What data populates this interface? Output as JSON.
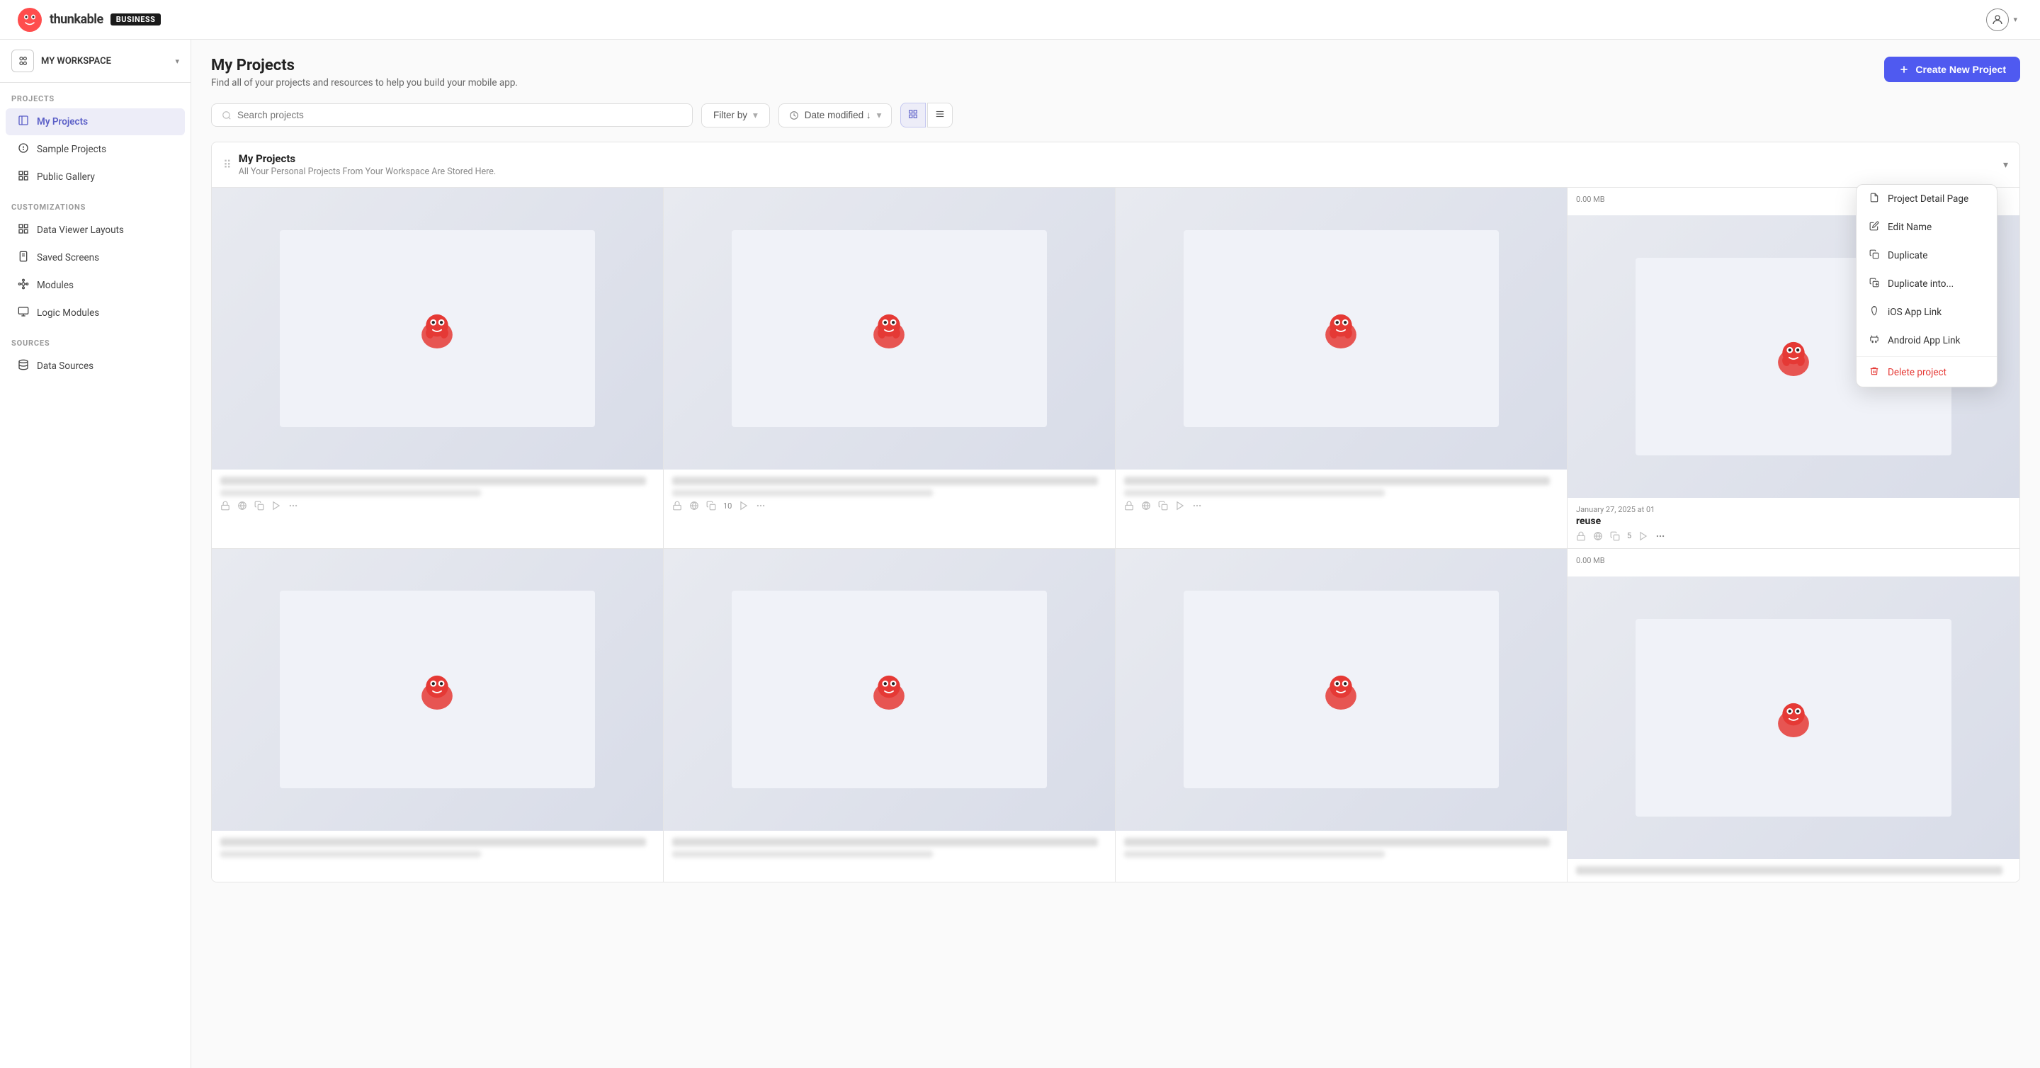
{
  "header": {
    "logo_text": "thunkable",
    "business_badge": "BUSINESS",
    "user_icon": "👤"
  },
  "sidebar": {
    "workspace_label": "MY WORKSPACE",
    "sections": [
      {
        "label": "PROJECTS",
        "items": [
          {
            "id": "my-projects",
            "label": "My Projects",
            "icon": "📄",
            "active": true
          },
          {
            "id": "sample-projects",
            "label": "Sample Projects",
            "icon": "💡",
            "active": false
          },
          {
            "id": "public-gallery",
            "label": "Public Gallery",
            "icon": "🖼",
            "active": false
          }
        ]
      },
      {
        "label": "CUSTOMIZATIONS",
        "items": [
          {
            "id": "data-viewer-layouts",
            "label": "Data Viewer Layouts",
            "icon": "⊞",
            "active": false
          },
          {
            "id": "saved-screens",
            "label": "Saved Screens",
            "icon": "📱",
            "active": false
          },
          {
            "id": "modules",
            "label": "Modules",
            "icon": "⚙",
            "active": false
          },
          {
            "id": "logic-modules",
            "label": "Logic Modules",
            "icon": "🖥",
            "active": false
          }
        ]
      },
      {
        "label": "SOURCES",
        "items": [
          {
            "id": "data-sources",
            "label": "Data Sources",
            "icon": "🗄",
            "active": false
          }
        ]
      }
    ]
  },
  "main": {
    "title": "My Projects",
    "subtitle": "Find all of your projects and resources to help you build your mobile app.",
    "create_button": "Create New Project",
    "search_placeholder": "Search projects",
    "filter_label": "Filter by",
    "sort_label": "Date modified ↓",
    "section": {
      "title": "My Projects",
      "description": "All Your Personal Projects From Your Workspace Are Stored Here."
    }
  },
  "context_menu": {
    "items": [
      {
        "id": "project-detail-page",
        "label": "Project Detail Page",
        "icon": "📄"
      },
      {
        "id": "edit-name",
        "label": "Edit Name",
        "icon": "✏"
      },
      {
        "id": "duplicate",
        "label": "Duplicate",
        "icon": "📋"
      },
      {
        "id": "duplicate-into",
        "label": "Duplicate into...",
        "icon": "📋"
      },
      {
        "id": "ios-app-link",
        "label": "iOS App Link",
        "icon": "🍎"
      },
      {
        "id": "android-app-link",
        "label": "Android App Link",
        "icon": "🤖"
      }
    ],
    "danger_items": [
      {
        "id": "delete-project",
        "label": "Delete project",
        "icon": "🗑"
      }
    ]
  },
  "special_card": {
    "size": "0.00 MB",
    "date": "January 27, 2025 at 01",
    "name": "reuse",
    "copy_count": "5"
  },
  "special_card_2": {
    "size": "0.00 MB"
  }
}
